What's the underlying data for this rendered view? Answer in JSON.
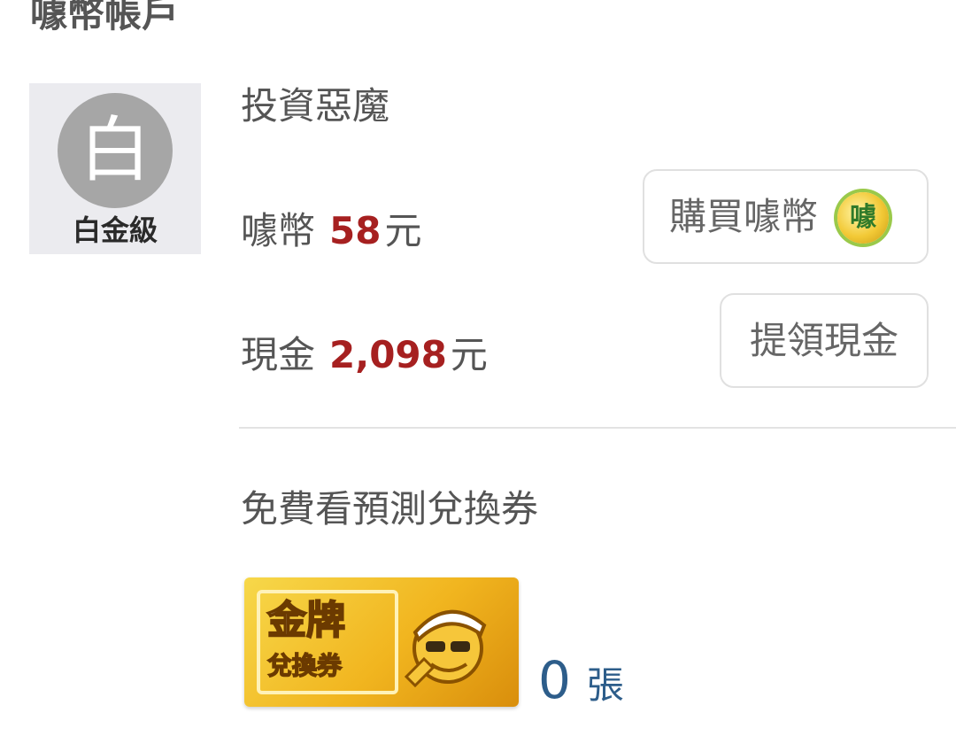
{
  "header": {
    "title": "噱幣帳戶"
  },
  "profile": {
    "avatar_char": "白",
    "level": "白金級",
    "username": "投資惡魔"
  },
  "coins": {
    "label": "噱幣",
    "amount": "58",
    "unit": "元"
  },
  "cash": {
    "label": "現金",
    "amount": "2,098",
    "unit": "元"
  },
  "buttons": {
    "buy_coins": "購買噱幣",
    "buy_coins_icon_char": "噱",
    "withdraw_cash": "提領現金"
  },
  "voucher": {
    "title": "免費看預測兌換券",
    "ticket_gold": "金牌",
    "ticket_label": "兌換券",
    "count": "0",
    "count_unit": "張"
  }
}
